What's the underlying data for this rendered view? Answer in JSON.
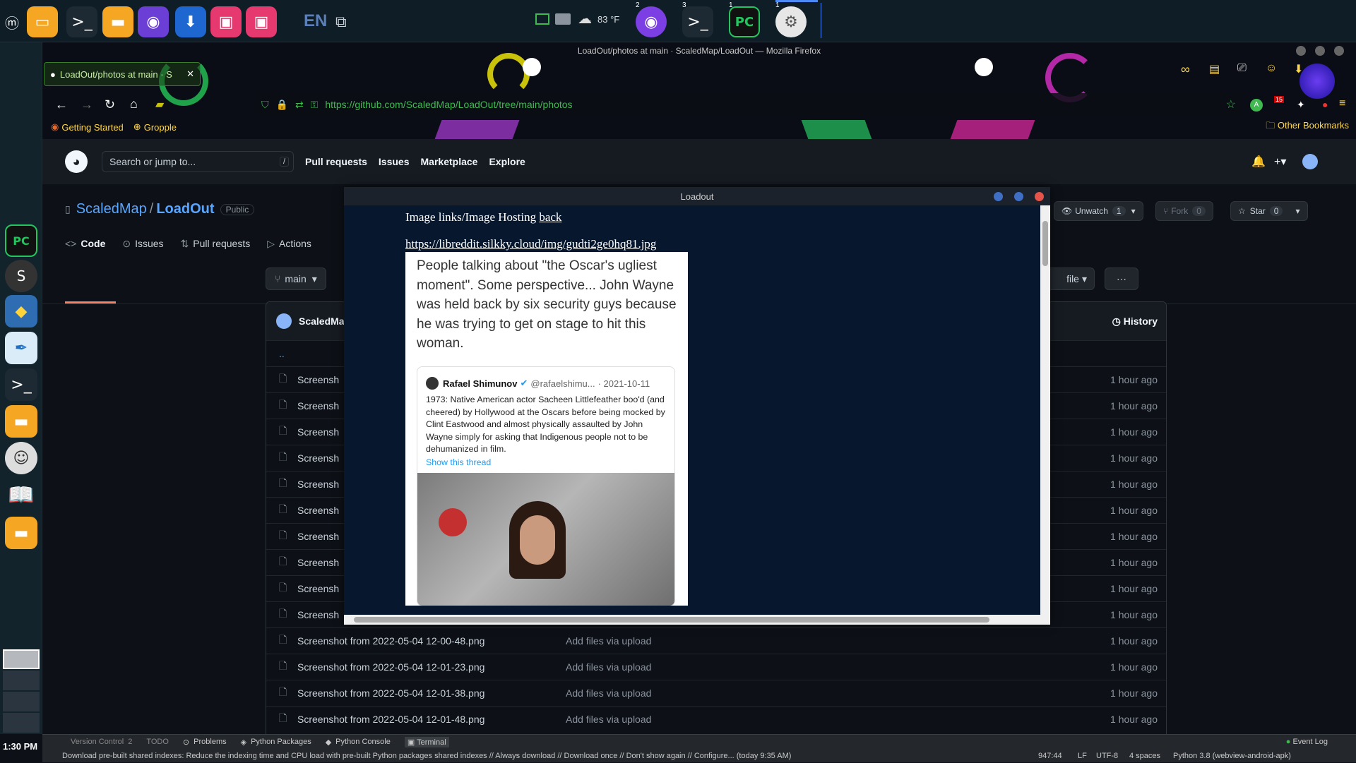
{
  "colors": {
    "accent": "#58a6ff",
    "ok": "#3fb950",
    "danger": "#e5534b",
    "panel": "#161b22"
  },
  "taskbar": {
    "lang": "EN",
    "temp": "83 °F",
    "badges": [
      "2",
      "3",
      "1",
      "1"
    ],
    "icons": [
      "linux-mint-menu-icon",
      "files-icon",
      "terminal-icon",
      "folder-icon",
      "firefox-icon",
      "software-manager-icon",
      "store-icon",
      "store-icon",
      "monitor-icon",
      "memory-icon",
      "weather-icon",
      "firefox-window-icon",
      "terminal-window-icon",
      "pycharm-window-icon",
      "settings-window-icon"
    ]
  },
  "dock": {
    "icons": [
      "pycharm-icon",
      "s-app-icon",
      "python-icon",
      "feather-icon",
      "terminal-icon",
      "folder-icon",
      "smiley-icon",
      "book-icon",
      "folder-icon"
    ],
    "clock": "1:30 PM"
  },
  "firefox": {
    "window_title": "LoadOut/photos at main · ScaledMap/LoadOut — Mozilla Firefox",
    "tab_title": "LoadOut/photos at main · S",
    "url": "https://github.com/ScaledMap/LoadOut/tree/main/photos",
    "bookmarks": [
      "Getting Started",
      "Gropple"
    ],
    "other_bookmarks": "Other Bookmarks",
    "extension_badge": "15"
  },
  "github": {
    "search_placeholder": "Search or jump to...",
    "search_key": "/",
    "nav": [
      "Pull requests",
      "Issues",
      "Marketplace",
      "Explore"
    ],
    "owner": "ScaledMap",
    "repo": "LoadOut",
    "visibility": "Public",
    "tabs": [
      "Code",
      "Issues",
      "Pull requests",
      "Actions"
    ],
    "unwatch": "Unwatch",
    "watch_count": "1",
    "fork": "Fork",
    "fork_count": "0",
    "star": "Star",
    "star_count": "0",
    "branch": "main",
    "file_btn": "file",
    "commit_user": "ScaledMa",
    "history": "History",
    "parent_dir": "..",
    "partial_row_label": "Screensh",
    "files": [
      {
        "name": "Screenshot from 2022-05-04 12-00-48.png",
        "msg": "Add files via upload",
        "age": "1 hour ago"
      },
      {
        "name": "Screenshot from 2022-05-04 12-01-23.png",
        "msg": "Add files via upload",
        "age": "1 hour ago"
      },
      {
        "name": "Screenshot from 2022-05-04 12-01-38.png",
        "msg": "Add files via upload",
        "age": "1 hour ago"
      },
      {
        "name": "Screenshot from 2022-05-04 12-01-48.png",
        "msg": "Add files via upload",
        "age": "1 hour ago"
      }
    ],
    "age": "1 hour ago"
  },
  "popup": {
    "title": "Loadout",
    "heading_text": "Image links/Image Hosting ",
    "back_link": "back",
    "image_link": "https://libreddit.silkky.cloud/img/gudti2ge0hq81.jpg",
    "meme_caption": "People talking about \"the Oscar's ugliest moment\". Some perspective... John Wayne was held back by six security guys because he was trying to get on stage to hit this woman.",
    "tweet": {
      "name": "Rafael Shimunov",
      "handle": "@rafaelshimu...",
      "date": "· 2021-10-11",
      "body": "1973: Native American actor Sacheen Littlefeather boo'd (and cheered) by Hollywood at the Oscars before being mocked by Clint Eastwood and almost physically assaulted by John Wayne simply for asking that Indigenous people not to be dehumanized in film.",
      "thread": "Show this thread"
    }
  },
  "ide_status": {
    "tabs": [
      "Version Control",
      "TODO",
      "Problems",
      "Python Packages",
      "Python Console",
      "Terminal"
    ],
    "version_num": "2",
    "event_log": "Event Log",
    "message": "Download pre-built shared indexes: Reduce the indexing time and CPU load with pre-built Python packages shared indexes // Always download // Download once // Don't show again // Configure... (today 9:35 AM)",
    "position": "947:44",
    "line_sep": "LF",
    "encoding": "UTF-8",
    "indent": "4 spaces",
    "interpreter": "Python 3.8 (webview-android-apk)"
  }
}
